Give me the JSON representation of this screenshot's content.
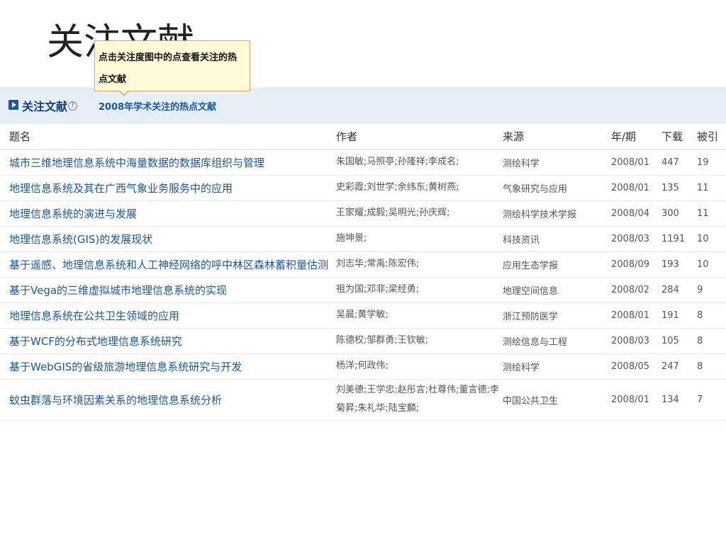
{
  "slide_title": "关注文献",
  "tooltip": {
    "text": "点击关注度图中的点查看关注的热点文献"
  },
  "panel": {
    "title": "关注文献",
    "help_label": "?",
    "subtitle": "2008年学术关注的热点文献"
  },
  "table": {
    "columns": [
      "题名",
      "作者",
      "来源",
      "年/期",
      "下载",
      "被引"
    ],
    "rows": [
      {
        "title": "城市三维地理信息系统中海量数据的数据库组织与管理",
        "authors": "朱国敏;马照亭;孙隆祥;李成名;",
        "source": "测绘科学",
        "issue": "2008/01",
        "downloads": "447",
        "cited": "19"
      },
      {
        "title": "地理信息系统及其在广西气象业务服务中的应用",
        "authors": "史彩霞;刘世学;余纬东;黄树燕;",
        "source": "气象研究与应用",
        "issue": "2008/01",
        "downloads": "135",
        "cited": "11"
      },
      {
        "title": "地理信息系统的演进与发展",
        "authors": "王家耀;成毅;吴明光;孙庆辉;",
        "source": "测绘科学技术学报",
        "issue": "2008/04",
        "downloads": "300",
        "cited": "11"
      },
      {
        "title": "地理信息系统(GIS)的发展现状",
        "authors": "施坤景;",
        "source": "科技资讯",
        "issue": "2008/03",
        "downloads": "1191",
        "cited": "10"
      },
      {
        "title": "基于遥感、地理信息系统和人工神经网络的呼中林区森林蓄积量估测",
        "authors": "刘志华;常禹;陈宏伟;",
        "source": "应用生态学报",
        "issue": "2008/09",
        "downloads": "193",
        "cited": "10"
      },
      {
        "title": "基于Vega的三维虚拟城市地理信息系统的实现",
        "authors": "祖为国;邓非;梁经勇;",
        "source": "地理空间信息",
        "issue": "2008/02",
        "downloads": "284",
        "cited": "9"
      },
      {
        "title": "地理信息系统在公共卫生领域的应用",
        "authors": "吴晨;黄学敏;",
        "source": "浙江预防医学",
        "issue": "2008/01",
        "downloads": "191",
        "cited": "8"
      },
      {
        "title": "基于WCF的分布式地理信息系统研究",
        "authors": "陈德权;邹群勇;王钦敏;",
        "source": "测绘信息与工程",
        "issue": "2008/03",
        "downloads": "105",
        "cited": "8"
      },
      {
        "title": "基于WebGIS的省级旅游地理信息系统研究与开发",
        "authors": "杨洋;何政伟;",
        "source": "测绘科学",
        "issue": "2008/05",
        "downloads": "247",
        "cited": "8"
      },
      {
        "title": "蚊虫群落与环境因素关系的地理信息系统分析",
        "authors": "刘美德;王学忠;赵彤言;杜尊伟;董言德;李菊昇;朱礼华;陆宝麟;",
        "source": "中国公共卫生",
        "issue": "2008/01",
        "downloads": "134",
        "cited": "7"
      }
    ]
  }
}
